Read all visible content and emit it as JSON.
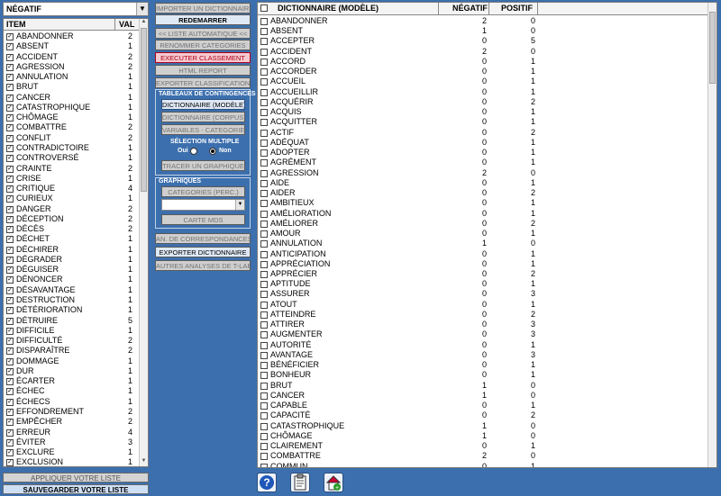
{
  "combo": {
    "value": "NÉGATIF"
  },
  "left_list": {
    "headers": {
      "item": "ITEM",
      "val": "VAL"
    },
    "rows": [
      [
        "ABANDONNER",
        "2"
      ],
      [
        "ABSENT",
        "1"
      ],
      [
        "ACCIDENT",
        "2"
      ],
      [
        "AGRESSION",
        "2"
      ],
      [
        "ANNULATION",
        "1"
      ],
      [
        "BRUT",
        "1"
      ],
      [
        "CANCER",
        "1"
      ],
      [
        "CATASTROPHIQUE",
        "1"
      ],
      [
        "CHÔMAGE",
        "1"
      ],
      [
        "COMBATTRE",
        "2"
      ],
      [
        "CONFLIT",
        "2"
      ],
      [
        "CONTRADICTOIRE",
        "1"
      ],
      [
        "CONTROVERSÉ",
        "1"
      ],
      [
        "CRAINTE",
        "2"
      ],
      [
        "CRISE",
        "1"
      ],
      [
        "CRITIQUE",
        "4"
      ],
      [
        "CURIEUX",
        "1"
      ],
      [
        "DANGER",
        "2"
      ],
      [
        "DÉCEPTION",
        "2"
      ],
      [
        "DÉCÈS",
        "2"
      ],
      [
        "DÉCHET",
        "1"
      ],
      [
        "DÉCHIRER",
        "1"
      ],
      [
        "DÉGRADER",
        "1"
      ],
      [
        "DÉGUISER",
        "1"
      ],
      [
        "DÉNONCER",
        "1"
      ],
      [
        "DÉSAVANTAGE",
        "1"
      ],
      [
        "DESTRUCTION",
        "1"
      ],
      [
        "DÉTÉRIORATION",
        "1"
      ],
      [
        "DÉTRUIRE",
        "5"
      ],
      [
        "DIFFICILE",
        "1"
      ],
      [
        "DIFFICULTÉ",
        "2"
      ],
      [
        "DISPARAÎTRE",
        "2"
      ],
      [
        "DOMMAGE",
        "1"
      ],
      [
        "DUR",
        "1"
      ],
      [
        "ÉCARTER",
        "1"
      ],
      [
        "ÉCHEC",
        "1"
      ],
      [
        "ÉCHECS",
        "1"
      ],
      [
        "EFFONDREMENT",
        "2"
      ],
      [
        "EMPÊCHER",
        "2"
      ],
      [
        "ERREUR",
        "4"
      ],
      [
        "ÉVITER",
        "3"
      ],
      [
        "EXCLURE",
        "1"
      ],
      [
        "EXCLUSION",
        "1"
      ]
    ],
    "apply_label": "APPLIQUER VOTRE LISTE",
    "save_label": "SAUVEGARDER VOTRE LISTE"
  },
  "middle": {
    "import": "IMPORTER UN DICTIONNAIRE",
    "restart": "REDEMARRER",
    "auto_list": "<< LISTE AUTOMATIQUE <<",
    "rename": "RENOMMER CATEGORIES",
    "execute": "EXECUTER CLASSEMENT",
    "html_report": "HTML REPORT",
    "export_class": "EXPORTER CLASSIFICATION",
    "contingency_title": "TABLEAUX DE CONTINGENCES",
    "dict_model": "DICTIONNAIRE (MODÈLE)",
    "dict_corpus": "DICTIONNAIRE (CORPUS)",
    "vars_cats": "VARIABLES - CATEGORIES",
    "multi_select": "SÉLECTION MULTIPLE",
    "yes": "Oui",
    "no": "Non",
    "trace": "TRACER UN GRAPHIQUE",
    "graphs_title": "GRAPHIQUES",
    "categories_perc": "CATEGORIES (PERC.)",
    "carte_mds": "CARTE MDS",
    "an_corresp": "AN. DE CORRESPONDANCES",
    "export_dict": "EXPORTER DICTIONNAIRE",
    "other_analyses": "AUTRES ANALYSES DE T-LAB"
  },
  "table": {
    "headers": {
      "dict": "DICTIONNAIRE (MODÈLE)",
      "neg": "NÉGATIF",
      "pos": "POSITIF"
    },
    "rows": [
      [
        "ABANDONNER",
        "2",
        "0"
      ],
      [
        "ABSENT",
        "1",
        "0"
      ],
      [
        "ACCEPTER",
        "0",
        "5"
      ],
      [
        "ACCIDENT",
        "2",
        "0"
      ],
      [
        "ACCORD",
        "0",
        "1"
      ],
      [
        "ACCORDER",
        "0",
        "1"
      ],
      [
        "ACCUEIL",
        "0",
        "1"
      ],
      [
        "ACCUEILLIR",
        "0",
        "1"
      ],
      [
        "ACQUÉRIR",
        "0",
        "2"
      ],
      [
        "ACQUIS",
        "0",
        "1"
      ],
      [
        "ACQUITTER",
        "0",
        "1"
      ],
      [
        "ACTIF",
        "0",
        "2"
      ],
      [
        "ADÉQUAT",
        "0",
        "1"
      ],
      [
        "ADOPTER",
        "0",
        "1"
      ],
      [
        "AGRÉMENT",
        "0",
        "1"
      ],
      [
        "AGRESSION",
        "2",
        "0"
      ],
      [
        "AIDE",
        "0",
        "1"
      ],
      [
        "AIDER",
        "0",
        "2"
      ],
      [
        "AMBITIEUX",
        "0",
        "1"
      ],
      [
        "AMÉLIORATION",
        "0",
        "1"
      ],
      [
        "AMÉLIORER",
        "0",
        "2"
      ],
      [
        "AMOUR",
        "0",
        "1"
      ],
      [
        "ANNULATION",
        "1",
        "0"
      ],
      [
        "ANTICIPATION",
        "0",
        "1"
      ],
      [
        "APPRÉCIATION",
        "0",
        "1"
      ],
      [
        "APPRÉCIER",
        "0",
        "2"
      ],
      [
        "APTITUDE",
        "0",
        "1"
      ],
      [
        "ASSURER",
        "0",
        "3"
      ],
      [
        "ATOUT",
        "0",
        "1"
      ],
      [
        "ATTEINDRE",
        "0",
        "2"
      ],
      [
        "ATTIRER",
        "0",
        "3"
      ],
      [
        "AUGMENTER",
        "0",
        "3"
      ],
      [
        "AUTORITÉ",
        "0",
        "1"
      ],
      [
        "AVANTAGE",
        "0",
        "3"
      ],
      [
        "BÉNÉFICIER",
        "0",
        "1"
      ],
      [
        "BONHEUR",
        "0",
        "1"
      ],
      [
        "BRUT",
        "1",
        "0"
      ],
      [
        "CANCER",
        "1",
        "0"
      ],
      [
        "CAPABLE",
        "0",
        "1"
      ],
      [
        "CAPACITÉ",
        "0",
        "2"
      ],
      [
        "CATASTROPHIQUE",
        "1",
        "0"
      ],
      [
        "CHÔMAGE",
        "1",
        "0"
      ],
      [
        "CLAIREMENT",
        "0",
        "1"
      ],
      [
        "COMBATTRE",
        "2",
        "0"
      ],
      [
        "COMMUN",
        "0",
        "1"
      ]
    ]
  },
  "icons": {
    "help": "help-icon",
    "clipboard": "clipboard-icon",
    "home": "home-icon"
  }
}
